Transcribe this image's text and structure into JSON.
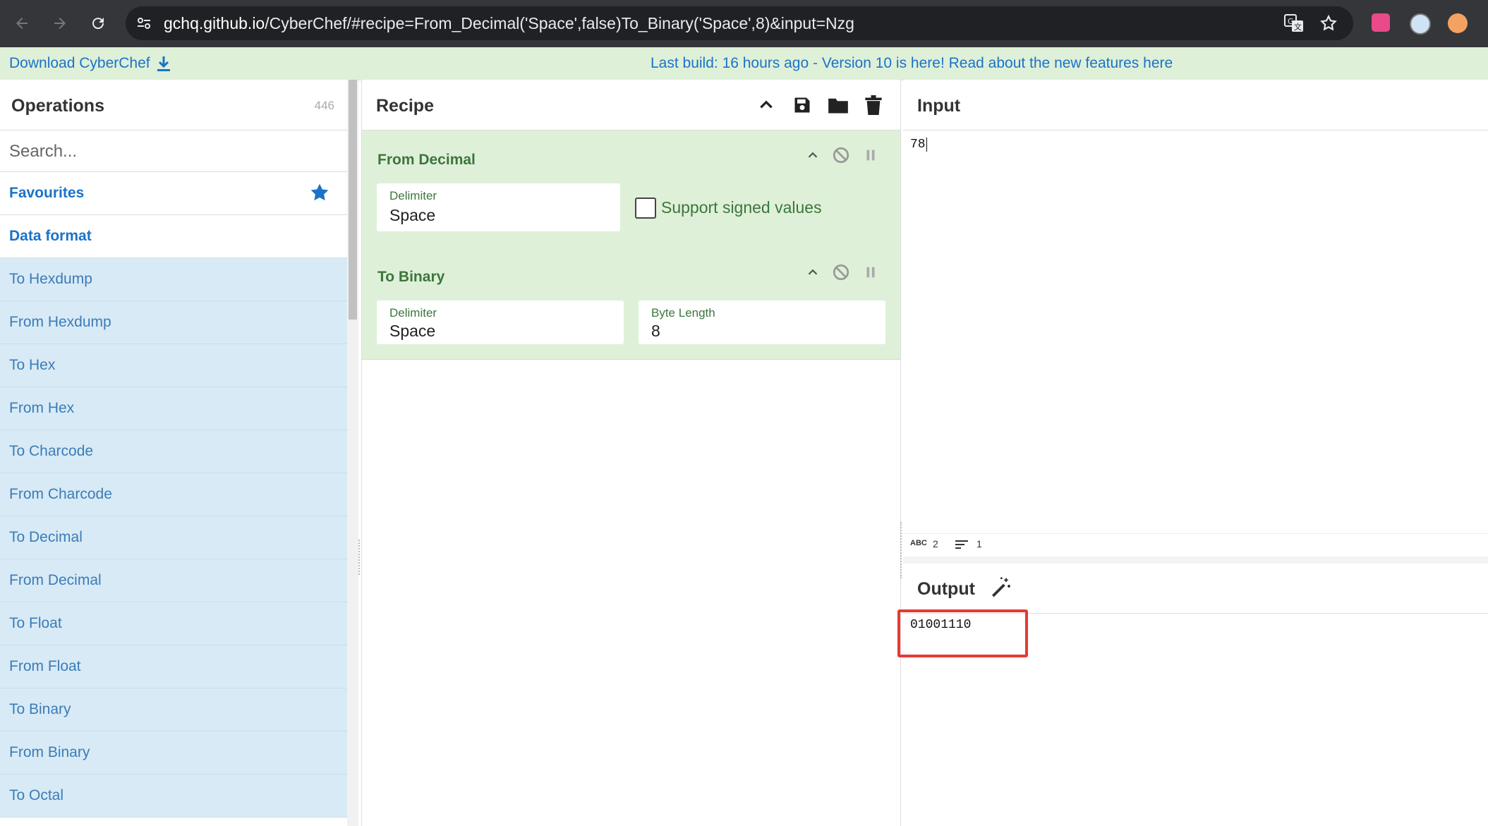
{
  "browser": {
    "url_host": "gchq.github.io",
    "url_path": "/CyberChef/#recipe=From_Decimal('Space',false)To_Binary('Space',8)&input=Nzg",
    "icons": [
      "back-icon",
      "forward-icon",
      "reload-icon",
      "site-settings-icon",
      "translate-icon",
      "bookmark-star-icon",
      "extension-icon",
      "profile-icon",
      "avatar"
    ]
  },
  "banner": {
    "download_label": "Download CyberChef",
    "last_build": "Last build: 16 hours ago",
    "separator": " - ",
    "version_message": "Version 10 is here! Read about the new features here"
  },
  "operations": {
    "title": "Operations",
    "count": "446",
    "search_placeholder": "Search...",
    "favourites_label": "Favourites",
    "category_label": "Data format",
    "items": [
      "To Hexdump",
      "From Hexdump",
      "To Hex",
      "From Hex",
      "To Charcode",
      "From Charcode",
      "To Decimal",
      "From Decimal",
      "To Float",
      "From Float",
      "To Binary",
      "From Binary",
      "To Octal"
    ]
  },
  "recipe": {
    "title": "Recipe",
    "ops": [
      {
        "name": "From Decimal",
        "delimiter_label": "Delimiter",
        "delimiter_value": "Space",
        "checkbox_label": "Support signed values",
        "checkbox_checked": false
      },
      {
        "name": "To Binary",
        "delimiter_label": "Delimiter",
        "delimiter_value": "Space",
        "byte_length_label": "Byte Length",
        "byte_length_value": "8"
      }
    ]
  },
  "input": {
    "title": "Input",
    "value": "78",
    "status_chars_label": "ABC",
    "status_chars": "2",
    "status_lines": "1"
  },
  "output": {
    "title": "Output",
    "value": "01001110",
    "highlight_color": "#e53935"
  },
  "colors": {
    "banner_bg": "#dff0d8",
    "link": "#1a73c8",
    "op_item_bg": "#d8eaf5",
    "recipe_op_bg": "#dff0d8"
  }
}
